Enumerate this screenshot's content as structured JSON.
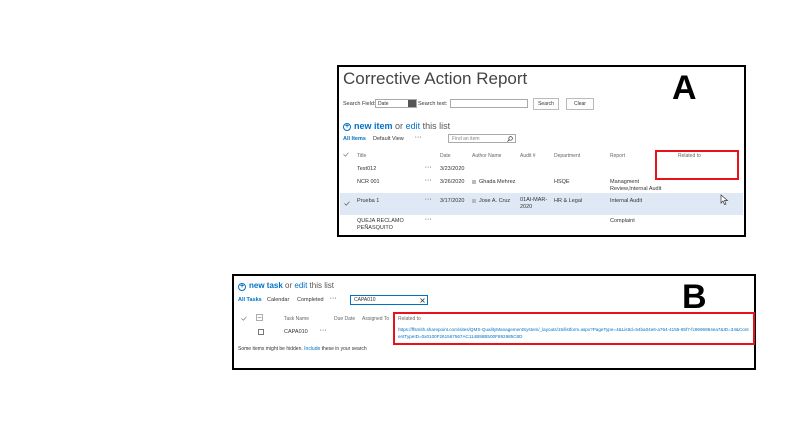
{
  "panel_a": {
    "label": "A",
    "title": "Corrective Action Report",
    "search_field_label": "Search Field:",
    "search_field_value": "Date",
    "search_text_label": "Search text:",
    "search_text_value": "",
    "search_button": "Search",
    "clear_button": "Clear",
    "new_item_prefix": "new item",
    "new_item_suffix_or": "or",
    "new_item_edit": "edit",
    "new_item_rest": "this list",
    "views": [
      "All Items",
      "Default View"
    ],
    "more": "···",
    "find_placeholder": "Find an item",
    "columns": [
      "Title",
      "Date",
      "Author Name",
      "Audit #",
      "Department",
      "Report",
      "Related to"
    ],
    "rows": [
      {
        "title": "Test012",
        "date": "3/23/2020",
        "author": "",
        "audit": "",
        "department": "",
        "report": ""
      },
      {
        "title": "NCR 001",
        "date": "3/26/2020",
        "author": "Ghada Mehrez",
        "audit": "",
        "department": "HSQE",
        "report": "Managment Review,Internal Audit"
      },
      {
        "title": "Prueba 1",
        "date": "3/17/2020",
        "author": "Jose A. Cruz",
        "audit": "01AI-MAR-2020",
        "department": "HR & Legal",
        "report": "Internal Audit"
      },
      {
        "title": "QUEJA RECLAMO PEÑASQUITO",
        "date": "",
        "author": "",
        "audit": "",
        "department": "",
        "report": "Complaint"
      }
    ]
  },
  "panel_b": {
    "label": "B",
    "new_task": "new task",
    "or": "or",
    "edit": "edit",
    "rest": "this list",
    "views": [
      "All Tasks",
      "Calendar",
      "Completed"
    ],
    "more": "···",
    "search_value": "CAPA010",
    "columns": [
      "Task Name",
      "Due Date",
      "Assigned To",
      "Related to"
    ],
    "row": {
      "task": "CAPA010",
      "related_url": "https://ffsmith.sharepoint.com/sites/QMS-QualityManagementSystem/_layouts/15/listform.aspx?PageType=4&ListId=54ba04e6-a764-4155-85f7-fc8696984ea7&ID=34&ContentTypeID=0x0100F261567567AC114B98B500F892985C8D"
    },
    "hidden_note_prefix": "Some items might be hidden.",
    "hidden_note_link": "Include",
    "hidden_note_suffix": "these in your search"
  },
  "colors": {
    "accent": "#0072c6",
    "highlight_box": "#e8121b",
    "selected_row": "#dfe9f5"
  },
  "icons": [
    "plus-circle-icon",
    "search-icon",
    "dropdown-arrow-icon",
    "checkmark-icon",
    "person-presence-icon",
    "mouse-cursor-icon",
    "close-icon",
    "attachment-icon"
  ]
}
